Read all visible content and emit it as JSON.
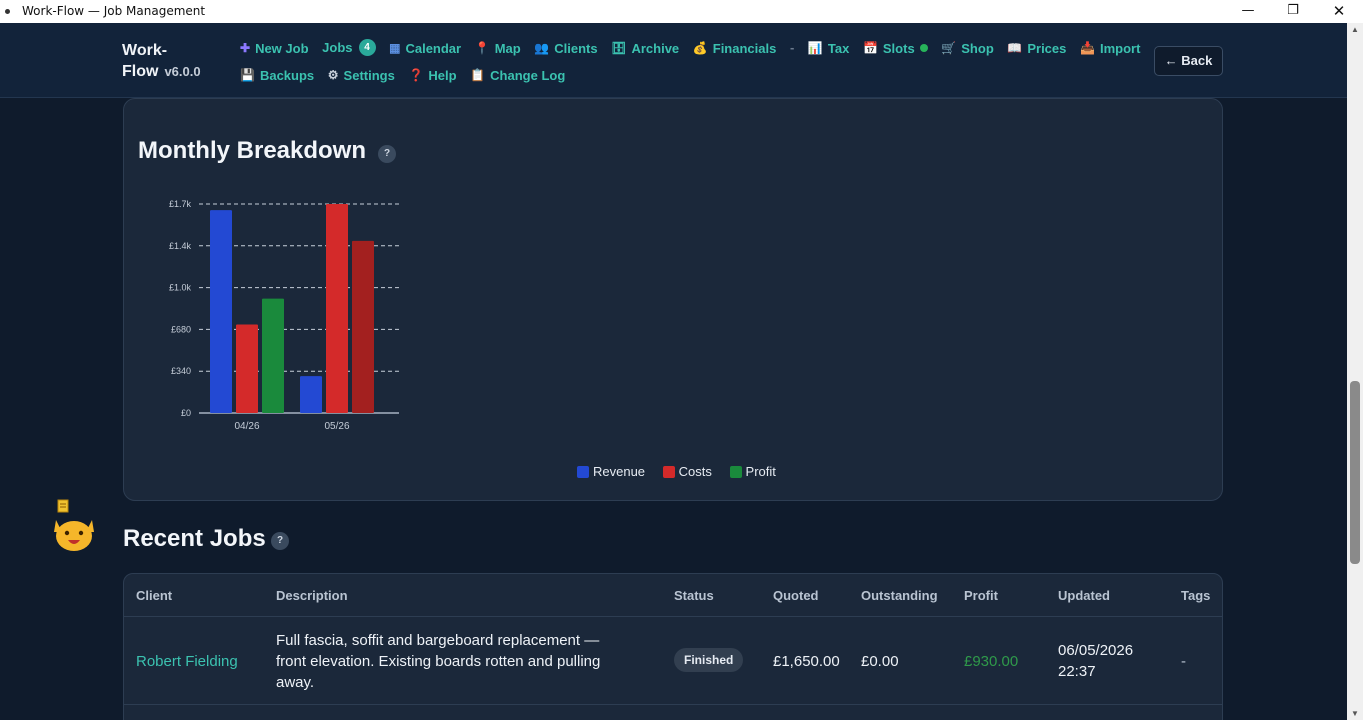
{
  "window": {
    "title": "Work-Flow — Job Management",
    "min_glyph": "—",
    "max_glyph": "❐",
    "close_glyph": "✕"
  },
  "header": {
    "brand_line1": "Work-",
    "brand_line2": "Flow",
    "version": "v6.0.0",
    "nav_row1": [
      {
        "icon": "plus-icon",
        "glyph": "✚",
        "label": "New Job"
      },
      {
        "icon": "",
        "glyph": "",
        "label": "Jobs",
        "badge": "4"
      },
      {
        "icon": "calendar-icon",
        "glyph": "▦",
        "label": "Calendar"
      },
      {
        "icon": "map-pin-icon",
        "glyph": "📍",
        "label": "Map"
      },
      {
        "icon": "people-icon",
        "glyph": "👥",
        "label": "Clients"
      },
      {
        "icon": "archive-icon",
        "glyph": "🗄",
        "label": "Archive"
      },
      {
        "icon": "money-bag-icon",
        "glyph": "💰",
        "label": "Financials"
      },
      {
        "icon": "bar-chart-icon",
        "glyph": "📊",
        "label": "Tax"
      },
      {
        "icon": "slots-icon",
        "glyph": "📅",
        "label": "Slots"
      },
      {
        "icon": "shop-icon",
        "glyph": "🛒",
        "label": "Shop"
      },
      {
        "icon": "price-book-icon",
        "glyph": "📖",
        "label": "Prices"
      },
      {
        "icon": "import-icon",
        "glyph": "📥",
        "label": "Import"
      }
    ],
    "nav_row2": [
      {
        "icon": "save-icon",
        "glyph": "💾",
        "label": "Backups"
      },
      {
        "icon": "gear-icon",
        "glyph": "⚙",
        "label": "Settings"
      },
      {
        "icon": "question-icon",
        "glyph": "❓",
        "label": "Help"
      },
      {
        "icon": "clipboard-icon",
        "glyph": "📋",
        "label": "Change Log"
      }
    ],
    "separator": "-",
    "back_label": "← Back"
  },
  "breakdown": {
    "title": "Monthly Breakdown",
    "help": "?"
  },
  "chart_data": {
    "type": "bar",
    "categories": [
      "04/26",
      "05/26"
    ],
    "series": [
      {
        "name": "Revenue",
        "color": "#2349d3",
        "values": [
          1650,
          300
        ]
      },
      {
        "name": "Costs",
        "color": "#d42a2a",
        "values": [
          720,
          1700
        ]
      },
      {
        "name": "Profit",
        "color": "#1a8a3c",
        "values": [
          930,
          -1400
        ]
      }
    ],
    "ylim": [
      0,
      1700
    ],
    "yticks": [
      0,
      340,
      680,
      1020,
      1360,
      1700
    ],
    "ytick_labels": [
      "£0",
      "£340",
      "£680",
      "£1.0k",
      "£1.4k",
      "£1.7k"
    ],
    "grid": true,
    "legend_position": "bottom-center",
    "title": "",
    "xlabel": "",
    "ylabel": ""
  },
  "recent_jobs": {
    "title": "Recent Jobs",
    "help": "?",
    "columns": [
      "Client",
      "Description",
      "Status",
      "Quoted",
      "Outstanding",
      "Profit",
      "Updated",
      "Tags"
    ],
    "rows": [
      {
        "client": "Robert Fielding",
        "description_lines": [
          "Full fascia, soffit and bargeboard replacement —",
          "front elevation. Existing boards rotten and pulling",
          "away."
        ],
        "status": "Finished",
        "quoted": "£1,650.00",
        "outstanding": "£0.00",
        "profit": "£930.00",
        "updated_date": "06/05/2026",
        "updated_time": "22:37",
        "tags": "-"
      }
    ]
  },
  "colors": {
    "accent": "#3bc2b0",
    "background": "#0f1b2c",
    "card": "#1b283a",
    "profit_positive": "#2f9a4a"
  }
}
